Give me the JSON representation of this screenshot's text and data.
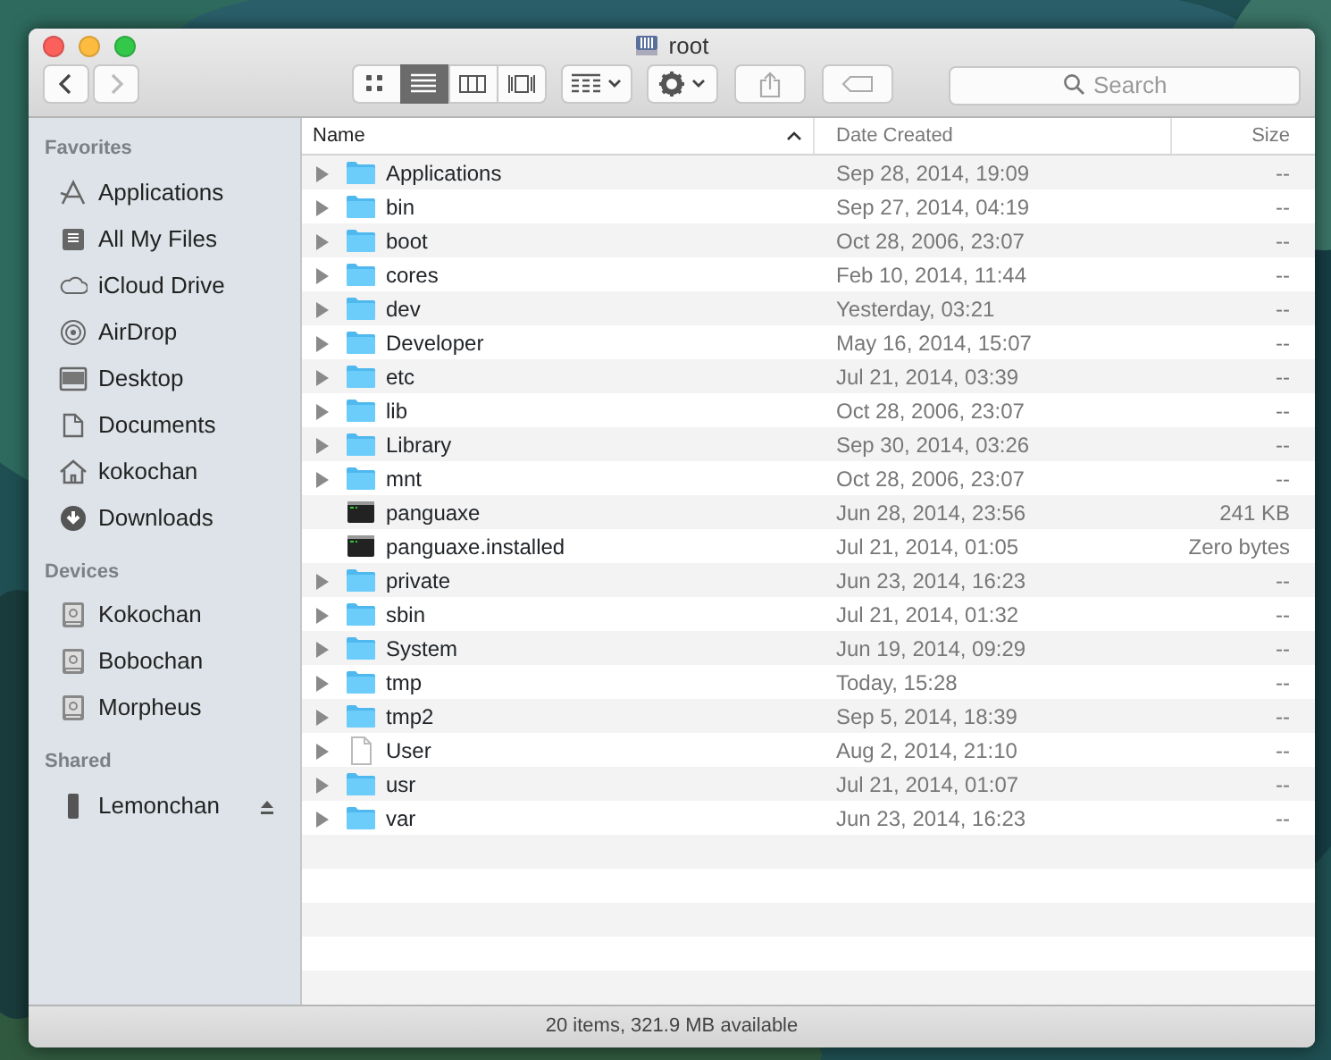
{
  "window": {
    "title": "root"
  },
  "toolbar": {
    "view_buttons": [
      {
        "kind": "icons",
        "selected": false
      },
      {
        "kind": "list",
        "selected": true
      },
      {
        "kind": "columns",
        "selected": false
      },
      {
        "kind": "coverflow",
        "selected": false
      }
    ],
    "search": {
      "placeholder": "Search"
    }
  },
  "sidebar": {
    "sections": [
      {
        "title": "Favorites",
        "items": [
          {
            "label": "Applications",
            "kind": "apps"
          },
          {
            "label": "All My Files",
            "kind": "files"
          },
          {
            "label": "iCloud Drive",
            "kind": "cloud"
          },
          {
            "label": "AirDrop",
            "kind": "airdrop"
          },
          {
            "label": "Desktop",
            "kind": "desktop"
          },
          {
            "label": "Documents",
            "kind": "documents"
          },
          {
            "label": "kokochan",
            "kind": "home"
          },
          {
            "label": "Downloads",
            "kind": "downloads"
          }
        ]
      },
      {
        "title": "Devices",
        "items": [
          {
            "label": "Kokochan",
            "kind": "disk"
          },
          {
            "label": "Bobochan",
            "kind": "disk"
          },
          {
            "label": "Morpheus",
            "kind": "disk"
          }
        ]
      },
      {
        "title": "Shared",
        "items": [
          {
            "label": "Lemonchan",
            "kind": "computer",
            "ejectable": true
          }
        ]
      }
    ]
  },
  "table": {
    "columns": [
      {
        "label": "Name",
        "sorted": true
      },
      {
        "label": "Date Created",
        "sorted": false
      },
      {
        "label": "Size",
        "sorted": false
      }
    ],
    "rows": [
      {
        "name": "Applications",
        "kind": "folder",
        "expandable": true,
        "date": "Sep 28, 2014, 19:09",
        "size": "--"
      },
      {
        "name": "bin",
        "kind": "folder",
        "expandable": true,
        "date": "Sep 27, 2014, 04:19",
        "size": "--"
      },
      {
        "name": "boot",
        "kind": "folder",
        "expandable": true,
        "date": "Oct 28, 2006, 23:07",
        "size": "--"
      },
      {
        "name": "cores",
        "kind": "folder",
        "expandable": true,
        "date": "Feb 10, 2014, 11:44",
        "size": "--"
      },
      {
        "name": "dev",
        "kind": "folder",
        "expandable": true,
        "date": "Yesterday, 03:21",
        "size": "--"
      },
      {
        "name": "Developer",
        "kind": "folder",
        "expandable": true,
        "date": "May 16, 2014, 15:07",
        "size": "--"
      },
      {
        "name": "etc",
        "kind": "folder",
        "expandable": true,
        "date": "Jul 21, 2014, 03:39",
        "size": "--"
      },
      {
        "name": "lib",
        "kind": "folder",
        "expandable": true,
        "date": "Oct 28, 2006, 23:07",
        "size": "--"
      },
      {
        "name": "Library",
        "kind": "folder",
        "expandable": true,
        "date": "Sep 30, 2014, 03:26",
        "size": "--"
      },
      {
        "name": "mnt",
        "kind": "folder",
        "expandable": true,
        "date": "Oct 28, 2006, 23:07",
        "size": "--"
      },
      {
        "name": "panguaxe",
        "kind": "executable",
        "expandable": false,
        "date": "Jun 28, 2014, 23:56",
        "size": "241 KB"
      },
      {
        "name": "panguaxe.installed",
        "kind": "executable",
        "expandable": false,
        "date": "Jul 21, 2014, 01:05",
        "size": "Zero bytes"
      },
      {
        "name": "private",
        "kind": "folder",
        "expandable": true,
        "date": "Jun 23, 2014, 16:23",
        "size": "--"
      },
      {
        "name": "sbin",
        "kind": "folder",
        "expandable": true,
        "date": "Jul 21, 2014, 01:32",
        "size": "--"
      },
      {
        "name": "System",
        "kind": "folder",
        "expandable": true,
        "date": "Jun 19, 2014, 09:29",
        "size": "--"
      },
      {
        "name": "tmp",
        "kind": "folder",
        "expandable": true,
        "date": "Today, 15:28",
        "size": "--"
      },
      {
        "name": "tmp2",
        "kind": "folder",
        "expandable": true,
        "date": "Sep 5, 2014, 18:39",
        "size": "--"
      },
      {
        "name": "User",
        "kind": "document",
        "expandable": true,
        "date": "Aug 2, 2014, 21:10",
        "size": "--"
      },
      {
        "name": "usr",
        "kind": "folder",
        "expandable": true,
        "date": "Jul 21, 2014, 01:07",
        "size": "--"
      },
      {
        "name": "var",
        "kind": "folder",
        "expandable": true,
        "date": "Jun 23, 2014, 16:23",
        "size": "--"
      }
    ]
  },
  "status_bar": "20 items, 321.9 MB available"
}
